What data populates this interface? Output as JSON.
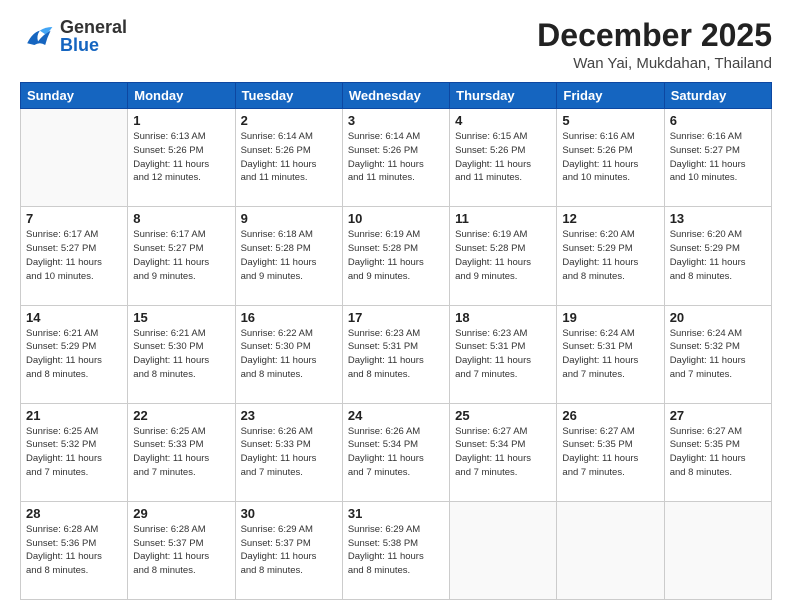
{
  "header": {
    "logo_general": "General",
    "logo_blue": "Blue",
    "month_title": "December 2025",
    "location": "Wan Yai, Mukdahan, Thailand"
  },
  "weekdays": [
    "Sunday",
    "Monday",
    "Tuesday",
    "Wednesday",
    "Thursday",
    "Friday",
    "Saturday"
  ],
  "weeks": [
    [
      {
        "day": "",
        "info": ""
      },
      {
        "day": "1",
        "info": "Sunrise: 6:13 AM\nSunset: 5:26 PM\nDaylight: 11 hours\nand 12 minutes."
      },
      {
        "day": "2",
        "info": "Sunrise: 6:14 AM\nSunset: 5:26 PM\nDaylight: 11 hours\nand 11 minutes."
      },
      {
        "day": "3",
        "info": "Sunrise: 6:14 AM\nSunset: 5:26 PM\nDaylight: 11 hours\nand 11 minutes."
      },
      {
        "day": "4",
        "info": "Sunrise: 6:15 AM\nSunset: 5:26 PM\nDaylight: 11 hours\nand 11 minutes."
      },
      {
        "day": "5",
        "info": "Sunrise: 6:16 AM\nSunset: 5:26 PM\nDaylight: 11 hours\nand 10 minutes."
      },
      {
        "day": "6",
        "info": "Sunrise: 6:16 AM\nSunset: 5:27 PM\nDaylight: 11 hours\nand 10 minutes."
      }
    ],
    [
      {
        "day": "7",
        "info": "Sunrise: 6:17 AM\nSunset: 5:27 PM\nDaylight: 11 hours\nand 10 minutes."
      },
      {
        "day": "8",
        "info": "Sunrise: 6:17 AM\nSunset: 5:27 PM\nDaylight: 11 hours\nand 9 minutes."
      },
      {
        "day": "9",
        "info": "Sunrise: 6:18 AM\nSunset: 5:28 PM\nDaylight: 11 hours\nand 9 minutes."
      },
      {
        "day": "10",
        "info": "Sunrise: 6:19 AM\nSunset: 5:28 PM\nDaylight: 11 hours\nand 9 minutes."
      },
      {
        "day": "11",
        "info": "Sunrise: 6:19 AM\nSunset: 5:28 PM\nDaylight: 11 hours\nand 9 minutes."
      },
      {
        "day": "12",
        "info": "Sunrise: 6:20 AM\nSunset: 5:29 PM\nDaylight: 11 hours\nand 8 minutes."
      },
      {
        "day": "13",
        "info": "Sunrise: 6:20 AM\nSunset: 5:29 PM\nDaylight: 11 hours\nand 8 minutes."
      }
    ],
    [
      {
        "day": "14",
        "info": "Sunrise: 6:21 AM\nSunset: 5:29 PM\nDaylight: 11 hours\nand 8 minutes."
      },
      {
        "day": "15",
        "info": "Sunrise: 6:21 AM\nSunset: 5:30 PM\nDaylight: 11 hours\nand 8 minutes."
      },
      {
        "day": "16",
        "info": "Sunrise: 6:22 AM\nSunset: 5:30 PM\nDaylight: 11 hours\nand 8 minutes."
      },
      {
        "day": "17",
        "info": "Sunrise: 6:23 AM\nSunset: 5:31 PM\nDaylight: 11 hours\nand 8 minutes."
      },
      {
        "day": "18",
        "info": "Sunrise: 6:23 AM\nSunset: 5:31 PM\nDaylight: 11 hours\nand 7 minutes."
      },
      {
        "day": "19",
        "info": "Sunrise: 6:24 AM\nSunset: 5:31 PM\nDaylight: 11 hours\nand 7 minutes."
      },
      {
        "day": "20",
        "info": "Sunrise: 6:24 AM\nSunset: 5:32 PM\nDaylight: 11 hours\nand 7 minutes."
      }
    ],
    [
      {
        "day": "21",
        "info": "Sunrise: 6:25 AM\nSunset: 5:32 PM\nDaylight: 11 hours\nand 7 minutes."
      },
      {
        "day": "22",
        "info": "Sunrise: 6:25 AM\nSunset: 5:33 PM\nDaylight: 11 hours\nand 7 minutes."
      },
      {
        "day": "23",
        "info": "Sunrise: 6:26 AM\nSunset: 5:33 PM\nDaylight: 11 hours\nand 7 minutes."
      },
      {
        "day": "24",
        "info": "Sunrise: 6:26 AM\nSunset: 5:34 PM\nDaylight: 11 hours\nand 7 minutes."
      },
      {
        "day": "25",
        "info": "Sunrise: 6:27 AM\nSunset: 5:34 PM\nDaylight: 11 hours\nand 7 minutes."
      },
      {
        "day": "26",
        "info": "Sunrise: 6:27 AM\nSunset: 5:35 PM\nDaylight: 11 hours\nand 7 minutes."
      },
      {
        "day": "27",
        "info": "Sunrise: 6:27 AM\nSunset: 5:35 PM\nDaylight: 11 hours\nand 8 minutes."
      }
    ],
    [
      {
        "day": "28",
        "info": "Sunrise: 6:28 AM\nSunset: 5:36 PM\nDaylight: 11 hours\nand 8 minutes."
      },
      {
        "day": "29",
        "info": "Sunrise: 6:28 AM\nSunset: 5:37 PM\nDaylight: 11 hours\nand 8 minutes."
      },
      {
        "day": "30",
        "info": "Sunrise: 6:29 AM\nSunset: 5:37 PM\nDaylight: 11 hours\nand 8 minutes."
      },
      {
        "day": "31",
        "info": "Sunrise: 6:29 AM\nSunset: 5:38 PM\nDaylight: 11 hours\nand 8 minutes."
      },
      {
        "day": "",
        "info": ""
      },
      {
        "day": "",
        "info": ""
      },
      {
        "day": "",
        "info": ""
      }
    ]
  ]
}
